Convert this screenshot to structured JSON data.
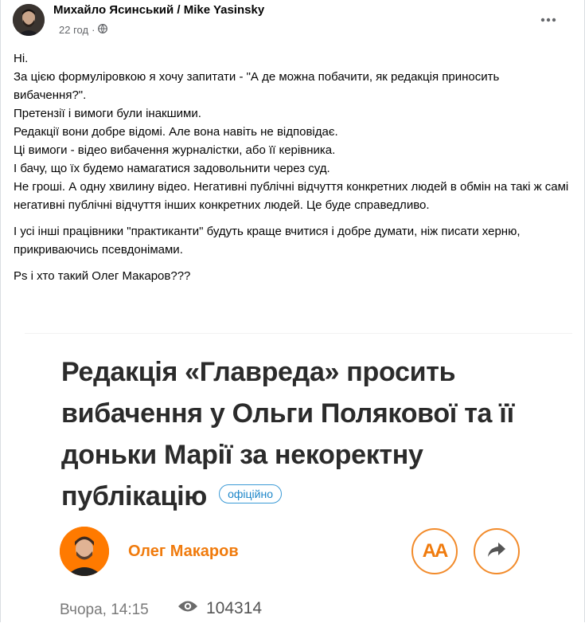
{
  "post": {
    "author_name": "Михайло Ясинський / Mike Yasinsky",
    "time": "22 год",
    "separator": "·",
    "icons": {
      "privacy": "globe-icon",
      "more": "more-dots-icon"
    },
    "paragraphs": [
      "Ні.",
      "За цією формуліровкою я хочу запитати - \"А де можна побачити, як редакція приносить вибачення?\".",
      "Претензії і вимоги були інакшими.",
      "Редакції  вони добре відомі. Але вона навіть не відповідає.",
      "Ці вимоги - відео вибачення журналістки, або її керівника.",
      "І бачу, що їх будемо намагатися задовольнити через суд.",
      "Не гроші. А одну хвилину відео. Негативні публічні відчуття конкретних людей в обмін на такі ж самі негативні публічні відчуття інших конкретних людей. Це буде справедливо.",
      "І усі інші працівники \"практиканти\" будуть краще вчитися і добре думати, ніж писати херню, прикриваючись псевдонімами.",
      "Ps і хто такий Олег Макаров???"
    ]
  },
  "article": {
    "headline": "Редакція «Главреда» просить вибачення у Ольги Полякової та її доньки Марії за некоректну публікацію",
    "badge": "офіційно",
    "author": "Олег Макаров",
    "font_button_label": "AA",
    "date": "Вчора, 14:15",
    "views": "104314",
    "icons": {
      "font": "font-size-icon",
      "share": "share-arrow-icon",
      "views": "eye-icon"
    },
    "colors": {
      "accent": "#f07b0d",
      "badge": "#1c86c9",
      "headline": "#2b2b2b"
    }
  }
}
